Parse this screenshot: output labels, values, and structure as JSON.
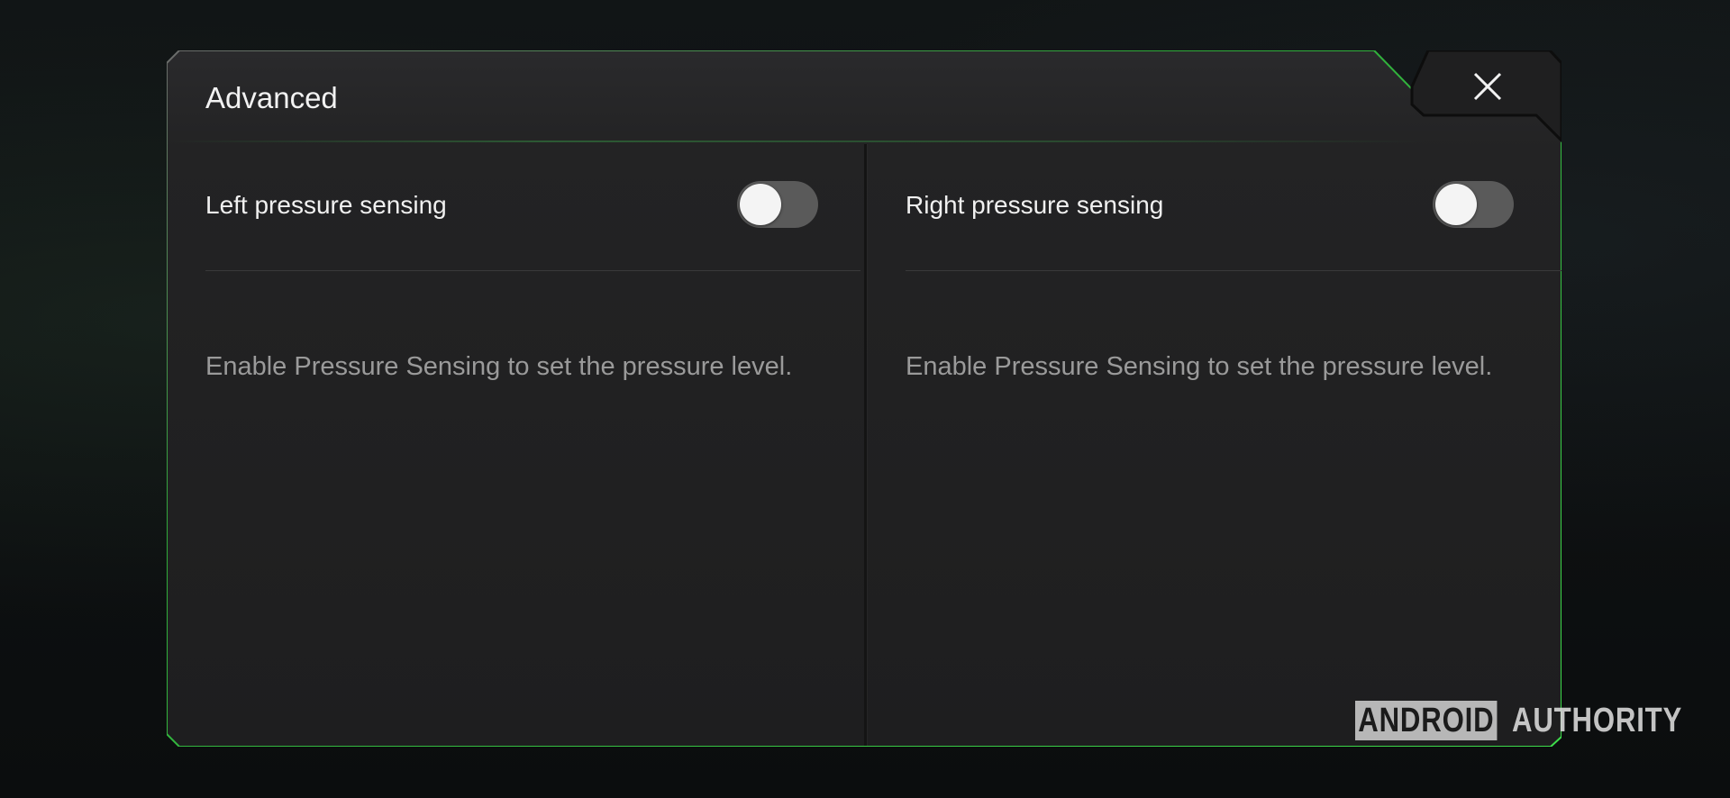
{
  "dialog": {
    "title": "Advanced",
    "close_icon": "close-icon",
    "accent_color": "#3ddc4a",
    "panels": [
      {
        "label": "Left pressure sensing",
        "toggle_on": false,
        "hint": "Enable Pressure Sensing to set the pressure level."
      },
      {
        "label": "Right pressure sensing",
        "toggle_on": false,
        "hint": "Enable Pressure Sensing to set the pressure level."
      }
    ]
  },
  "watermark": {
    "boxed": "ANDROID",
    "text": "AUTHORITY"
  }
}
